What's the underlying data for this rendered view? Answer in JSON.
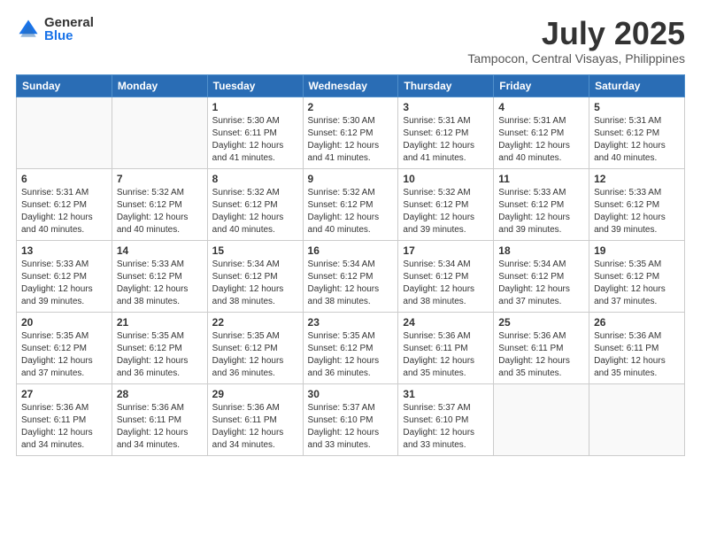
{
  "logo": {
    "general": "General",
    "blue": "Blue"
  },
  "title": "July 2025",
  "location": "Tampocon, Central Visayas, Philippines",
  "days_of_week": [
    "Sunday",
    "Monday",
    "Tuesday",
    "Wednesday",
    "Thursday",
    "Friday",
    "Saturday"
  ],
  "weeks": [
    [
      {
        "day": "",
        "info": ""
      },
      {
        "day": "",
        "info": ""
      },
      {
        "day": "1",
        "info": "Sunrise: 5:30 AM\nSunset: 6:11 PM\nDaylight: 12 hours and 41 minutes."
      },
      {
        "day": "2",
        "info": "Sunrise: 5:30 AM\nSunset: 6:12 PM\nDaylight: 12 hours and 41 minutes."
      },
      {
        "day": "3",
        "info": "Sunrise: 5:31 AM\nSunset: 6:12 PM\nDaylight: 12 hours and 41 minutes."
      },
      {
        "day": "4",
        "info": "Sunrise: 5:31 AM\nSunset: 6:12 PM\nDaylight: 12 hours and 40 minutes."
      },
      {
        "day": "5",
        "info": "Sunrise: 5:31 AM\nSunset: 6:12 PM\nDaylight: 12 hours and 40 minutes."
      }
    ],
    [
      {
        "day": "6",
        "info": "Sunrise: 5:31 AM\nSunset: 6:12 PM\nDaylight: 12 hours and 40 minutes."
      },
      {
        "day": "7",
        "info": "Sunrise: 5:32 AM\nSunset: 6:12 PM\nDaylight: 12 hours and 40 minutes."
      },
      {
        "day": "8",
        "info": "Sunrise: 5:32 AM\nSunset: 6:12 PM\nDaylight: 12 hours and 40 minutes."
      },
      {
        "day": "9",
        "info": "Sunrise: 5:32 AM\nSunset: 6:12 PM\nDaylight: 12 hours and 40 minutes."
      },
      {
        "day": "10",
        "info": "Sunrise: 5:32 AM\nSunset: 6:12 PM\nDaylight: 12 hours and 39 minutes."
      },
      {
        "day": "11",
        "info": "Sunrise: 5:33 AM\nSunset: 6:12 PM\nDaylight: 12 hours and 39 minutes."
      },
      {
        "day": "12",
        "info": "Sunrise: 5:33 AM\nSunset: 6:12 PM\nDaylight: 12 hours and 39 minutes."
      }
    ],
    [
      {
        "day": "13",
        "info": "Sunrise: 5:33 AM\nSunset: 6:12 PM\nDaylight: 12 hours and 39 minutes."
      },
      {
        "day": "14",
        "info": "Sunrise: 5:33 AM\nSunset: 6:12 PM\nDaylight: 12 hours and 38 minutes."
      },
      {
        "day": "15",
        "info": "Sunrise: 5:34 AM\nSunset: 6:12 PM\nDaylight: 12 hours and 38 minutes."
      },
      {
        "day": "16",
        "info": "Sunrise: 5:34 AM\nSunset: 6:12 PM\nDaylight: 12 hours and 38 minutes."
      },
      {
        "day": "17",
        "info": "Sunrise: 5:34 AM\nSunset: 6:12 PM\nDaylight: 12 hours and 38 minutes."
      },
      {
        "day": "18",
        "info": "Sunrise: 5:34 AM\nSunset: 6:12 PM\nDaylight: 12 hours and 37 minutes."
      },
      {
        "day": "19",
        "info": "Sunrise: 5:35 AM\nSunset: 6:12 PM\nDaylight: 12 hours and 37 minutes."
      }
    ],
    [
      {
        "day": "20",
        "info": "Sunrise: 5:35 AM\nSunset: 6:12 PM\nDaylight: 12 hours and 37 minutes."
      },
      {
        "day": "21",
        "info": "Sunrise: 5:35 AM\nSunset: 6:12 PM\nDaylight: 12 hours and 36 minutes."
      },
      {
        "day": "22",
        "info": "Sunrise: 5:35 AM\nSunset: 6:12 PM\nDaylight: 12 hours and 36 minutes."
      },
      {
        "day": "23",
        "info": "Sunrise: 5:35 AM\nSunset: 6:12 PM\nDaylight: 12 hours and 36 minutes."
      },
      {
        "day": "24",
        "info": "Sunrise: 5:36 AM\nSunset: 6:11 PM\nDaylight: 12 hours and 35 minutes."
      },
      {
        "day": "25",
        "info": "Sunrise: 5:36 AM\nSunset: 6:11 PM\nDaylight: 12 hours and 35 minutes."
      },
      {
        "day": "26",
        "info": "Sunrise: 5:36 AM\nSunset: 6:11 PM\nDaylight: 12 hours and 35 minutes."
      }
    ],
    [
      {
        "day": "27",
        "info": "Sunrise: 5:36 AM\nSunset: 6:11 PM\nDaylight: 12 hours and 34 minutes."
      },
      {
        "day": "28",
        "info": "Sunrise: 5:36 AM\nSunset: 6:11 PM\nDaylight: 12 hours and 34 minutes."
      },
      {
        "day": "29",
        "info": "Sunrise: 5:36 AM\nSunset: 6:11 PM\nDaylight: 12 hours and 34 minutes."
      },
      {
        "day": "30",
        "info": "Sunrise: 5:37 AM\nSunset: 6:10 PM\nDaylight: 12 hours and 33 minutes."
      },
      {
        "day": "31",
        "info": "Sunrise: 5:37 AM\nSunset: 6:10 PM\nDaylight: 12 hours and 33 minutes."
      },
      {
        "day": "",
        "info": ""
      },
      {
        "day": "",
        "info": ""
      }
    ]
  ]
}
